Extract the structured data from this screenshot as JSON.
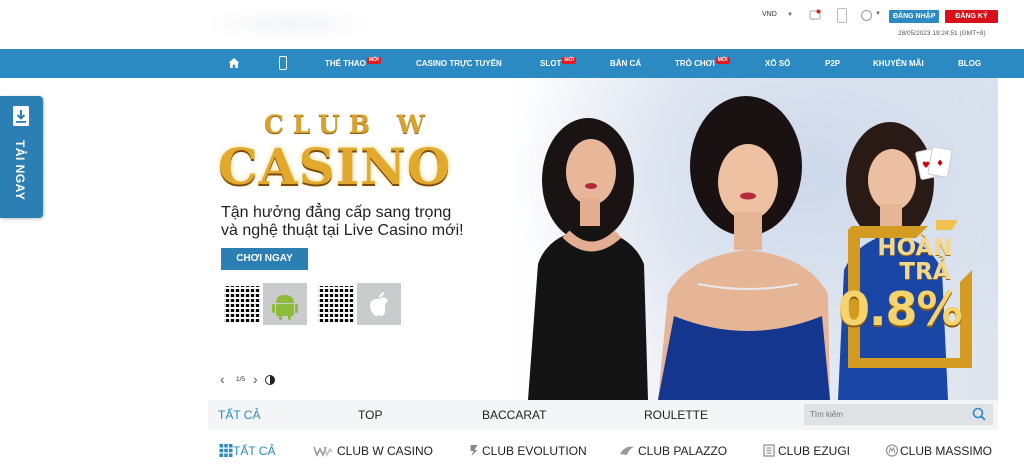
{
  "header": {
    "currency": "VND",
    "login_label": "ĐĂNG NHẬP",
    "register_label": "ĐĂNG KÝ",
    "datetime": "28/05/2023 19:24:51 (GMT+8)"
  },
  "nav": {
    "items": [
      {
        "label": "THỂ THAO",
        "badge": "MỚI"
      },
      {
        "label": "CASINO TRỰC TUYẾN",
        "badge": ""
      },
      {
        "label": "SLOT",
        "badge": "MỚI"
      },
      {
        "label": "BẮN CÁ",
        "badge": ""
      },
      {
        "label": "TRÒ CHƠI",
        "badge": "MỚI"
      },
      {
        "label": "XỔ SỐ",
        "badge": ""
      },
      {
        "label": "P2P",
        "badge": ""
      },
      {
        "label": "KHUYẾN MÃI",
        "badge": ""
      },
      {
        "label": "BLOG",
        "badge": ""
      }
    ]
  },
  "side": {
    "download_label": "TẢI NGAY"
  },
  "banner": {
    "brand_top": "CLUB W",
    "brand_main": "CASINO",
    "line1": "Tận hưởng đẳng cấp sang trọng",
    "line2": "và nghệ thuật tại Live Casino mới!",
    "cta_label": "CHƠI NGAY",
    "promo_word1": "HOÀN",
    "promo_word2": "TRẢ",
    "promo_value": "0.8%",
    "pager": "1/5"
  },
  "tabs": {
    "items": [
      "TẤT CẢ",
      "TOP",
      "BACCARAT",
      "ROULETTE"
    ],
    "search_placeholder": "Tìm kiếm"
  },
  "providers": {
    "items": [
      "TẤT CẢ",
      "CLUB W CASINO",
      "CLUB EVOLUTION",
      "CLUB PALAZZO",
      "CLUB EZUGI",
      "CLUB MASSIMO"
    ]
  },
  "colors": {
    "primary": "#2c8ac2",
    "danger": "#d8101a",
    "gold": "#e2a92d"
  }
}
